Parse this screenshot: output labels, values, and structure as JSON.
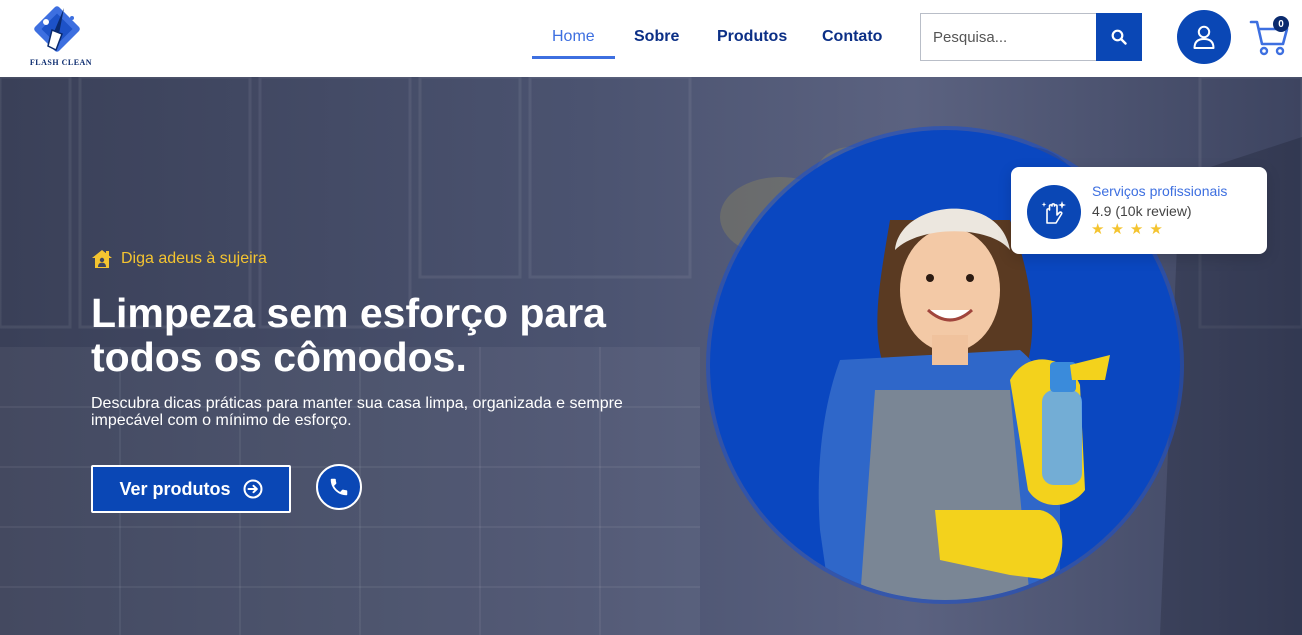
{
  "logo": {
    "text": "FLASH CLEAN"
  },
  "nav": {
    "items": [
      {
        "label": "Home",
        "active": true
      },
      {
        "label": "Sobre",
        "active": false
      },
      {
        "label": "Produtos",
        "active": false
      },
      {
        "label": "Contato",
        "active": false
      }
    ]
  },
  "search": {
    "placeholder": "Pesquisa..."
  },
  "cart": {
    "count": "0"
  },
  "hero": {
    "eyebrow": "Diga adeus à sujeira",
    "title": "Limpeza sem esforço para todos os cômodos.",
    "subtitle": "Descubra dicas práticas para manter sua casa limpa, organizada e sempre impecável com o mínimo de esforço.",
    "cta_label": "Ver produtos"
  },
  "review": {
    "title": "Serviços profissionais",
    "score": "4.9 (10k review)",
    "stars": 4
  },
  "colors": {
    "brand": "#0a47b5",
    "accent": "#3d6fe0",
    "eyebrow": "#f4c430",
    "nav_text": "#0b2f86"
  },
  "icons": {
    "search": "search-icon",
    "user": "user-icon",
    "cart": "cart-icon",
    "house": "house-icon",
    "arrow": "arrow-right-circle-icon",
    "phone": "phone-icon",
    "hand": "sparkle-hand-icon"
  }
}
